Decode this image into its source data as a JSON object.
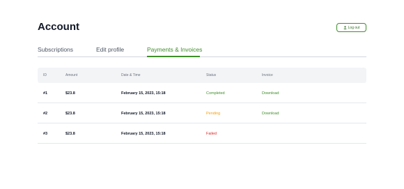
{
  "page": {
    "title": "Account"
  },
  "header": {
    "logout_label": "Log out",
    "logout_icon": "user-icon"
  },
  "tabs": [
    {
      "label": "Subscriptions",
      "active": false
    },
    {
      "label": "Edit profile",
      "active": false
    },
    {
      "label": "Payments & Invoices",
      "active": true
    }
  ],
  "table": {
    "columns": [
      "ID",
      "Amount",
      "Date & Time",
      "Status",
      "Invoice"
    ],
    "rows": [
      {
        "id": "#1",
        "amount": "$23.8",
        "datetime": "February 15, 2023, 15:18",
        "status": "Completed",
        "invoice": "Download"
      },
      {
        "id": "#2",
        "amount": "$23.8",
        "datetime": "February 15, 2023, 15:18",
        "status": "Pending",
        "invoice": "Download"
      },
      {
        "id": "#3",
        "amount": "$23.8",
        "datetime": "February 15, 2023, 15:18",
        "status": "Failed",
        "invoice": ""
      }
    ]
  },
  "colors": {
    "accent": "#3f8f2a",
    "status_completed": "#3f8f2a",
    "status_pending": "#f59e0b",
    "status_failed": "#dc2626"
  }
}
